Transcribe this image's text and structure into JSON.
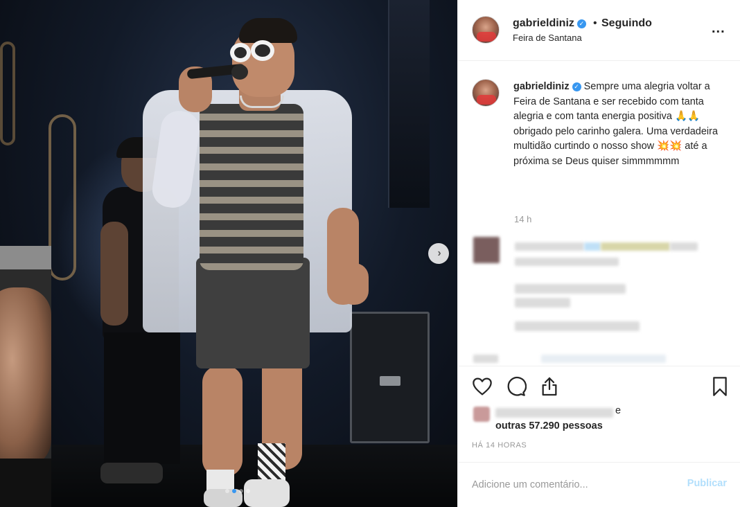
{
  "post": {
    "username": "gabrieldiniz",
    "bullet": "•",
    "follow_status": "Seguindo",
    "location": "Feira de Santana",
    "more_label": "..."
  },
  "caption": {
    "username": "gabrieldiniz",
    "text": "Sempre uma alegria voltar a Feira de Santana e ser recebido com tanta alegria e com tanta energia positiva 🙏🙏 obrigado pelo carinho galera. Uma verdadeira multidão curtindo o nosso show 💥💥 até a próxima se Deus quiser simmmmmm",
    "time": "14 h"
  },
  "likes": {
    "conjunction": "e",
    "others": "outras 57.290 pessoas"
  },
  "timestamp": "HÁ 14 HORAS",
  "comment": {
    "placeholder": "Adicione um comentário...",
    "publish_label": "Publicar"
  },
  "carousel": {
    "next_arrow": "›",
    "dot_count": 4,
    "active_dot": 1
  },
  "icons": {
    "like": "heart-icon",
    "comment": "comment-icon",
    "share": "share-icon",
    "save": "bookmark-icon"
  },
  "colors": {
    "verified": "#3897f0",
    "publish_disabled": "#b2dffc",
    "muted_text": "#999999",
    "text": "#262626"
  }
}
